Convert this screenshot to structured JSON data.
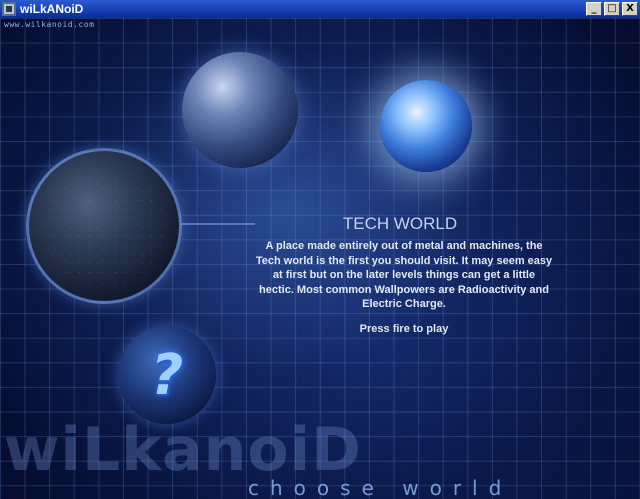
{
  "window": {
    "title": "wiLkANoiD",
    "minimize_label": "_",
    "maximize_label": "□",
    "close_label": "X"
  },
  "game": {
    "site_url": "www.wilkanoid.com",
    "world_title": "TECH WORLD",
    "world_description": "A place made entirely out of metal and machines, the Tech world  is the first you should visit. It may seem easy at first but on the later levels things can get a little hectic. Most common Wallpowers are Radioactivity and Electric Charge.",
    "prompt": "Press fire to play",
    "footer_logo": "wiLkanoiD",
    "footer_caption": "choose world",
    "help_glyph": "?"
  },
  "colors": {
    "background": "#081238",
    "grid_line": "#7aaaff",
    "text_main": "#e2e8f4",
    "title_bar": "#0a2a9c"
  }
}
